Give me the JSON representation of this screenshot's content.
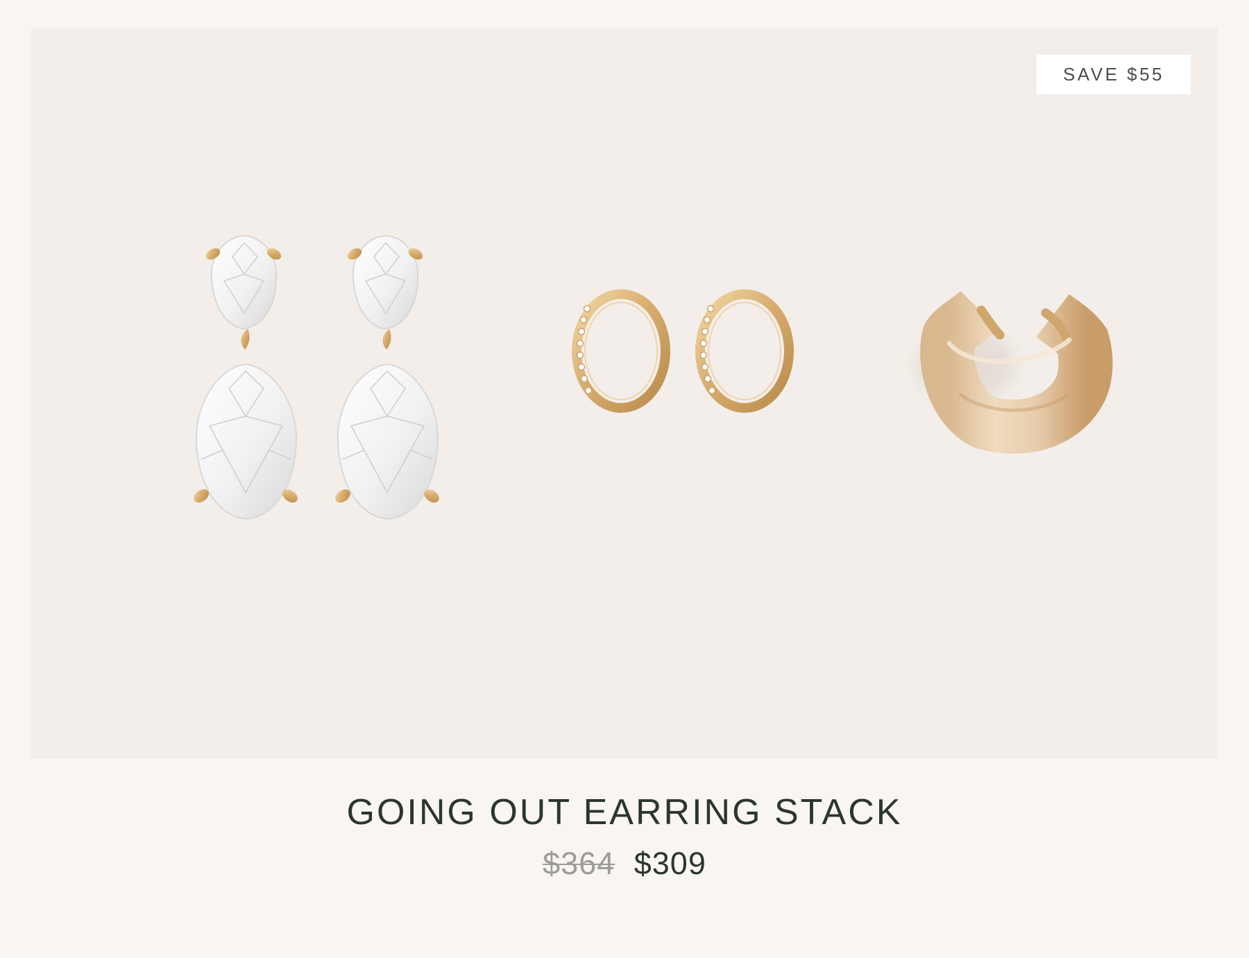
{
  "product": {
    "badge": "SAVE $55",
    "title": "GOING OUT EARRING STACK",
    "price_original": "$364",
    "price_sale": "$309",
    "items": [
      {
        "icon": "pear-drop-earrings-icon"
      },
      {
        "icon": "pave-huggie-hoops-icon"
      },
      {
        "icon": "ear-cuff-icon"
      }
    ]
  },
  "colors": {
    "page_background": "#f9f5f1",
    "panel_background": "#f3eee9",
    "badge_background": "#ffffff",
    "badge_text": "#4a4e50",
    "title_text": "#2a3630",
    "strike_price": "#9c9c9c",
    "gold": "#d9b47a"
  }
}
